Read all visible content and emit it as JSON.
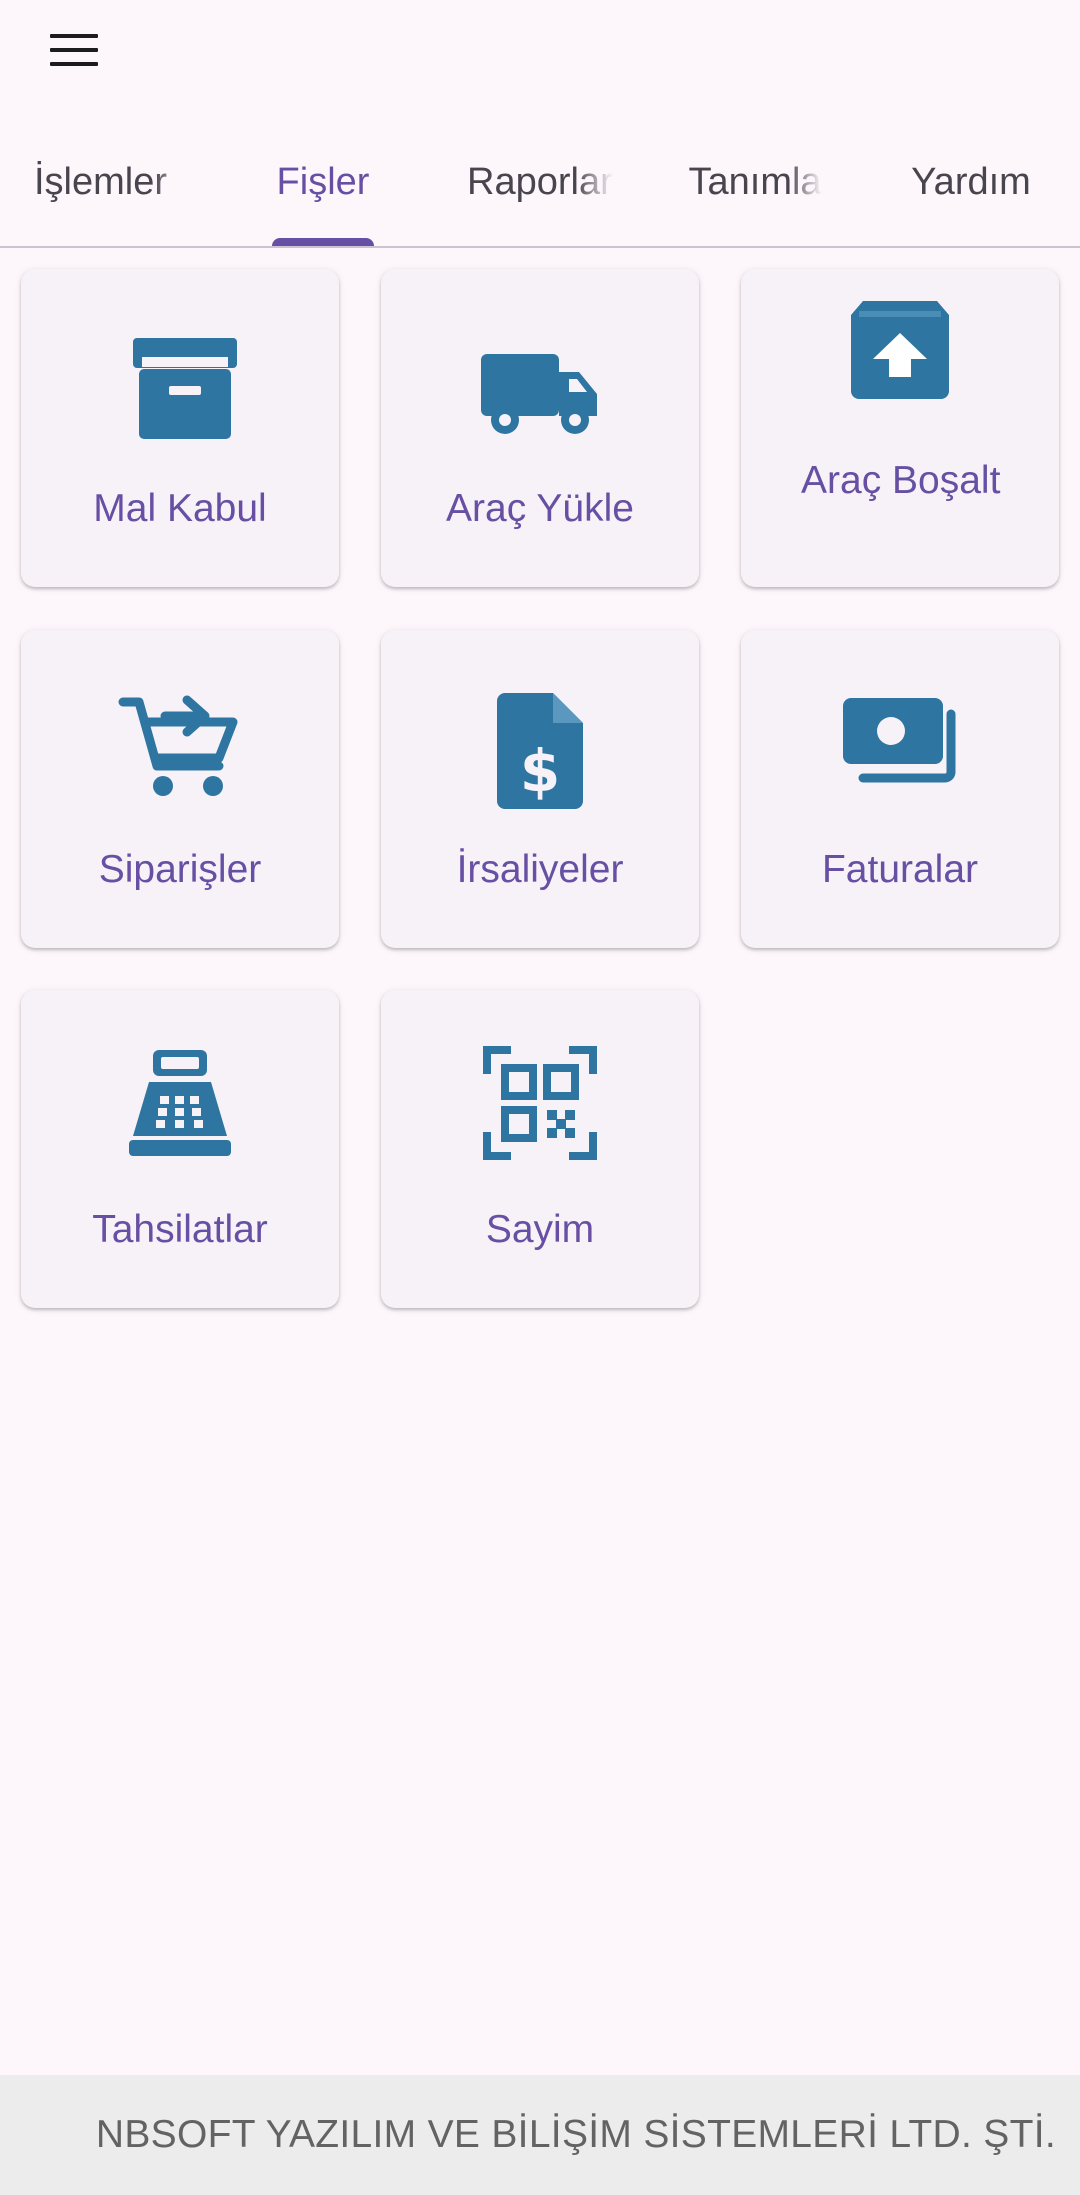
{
  "appbar": {
    "menu_icon": "menu-icon"
  },
  "tabs": [
    {
      "label": "İşlemler",
      "active": false
    },
    {
      "label": "Fişler",
      "active": true
    },
    {
      "label": "Raporlar",
      "active": false
    },
    {
      "label": "Tanımlar",
      "active": false
    },
    {
      "label": "Yardım",
      "active": false
    }
  ],
  "cards": [
    {
      "label": "Mal Kabul",
      "icon": "archive-box-icon"
    },
    {
      "label": "Araç Yükle",
      "icon": "truck-icon"
    },
    {
      "label": "Araç Boşalt",
      "icon": "box-unload-icon"
    },
    {
      "label": "Siparişler",
      "icon": "cart-arrow-icon"
    },
    {
      "label": "İrsaliyeler",
      "icon": "invoice-dollar-icon"
    },
    {
      "label": "Faturalar",
      "icon": "money-bill-icon"
    },
    {
      "label": "Tahsilatlar",
      "icon": "cash-register-icon"
    },
    {
      "label": "Sayim",
      "icon": "qr-code-icon"
    }
  ],
  "footer": {
    "text": "NBSOFT YAZILIM VE BİLİŞİM SİSTEMLERİ LTD. ŞTİ."
  },
  "colors": {
    "accent": "#6750a4",
    "icon": "#2e76a1",
    "background": "#fdf7fc",
    "card": "#f7f2f8",
    "footer_bg": "#ececec"
  }
}
